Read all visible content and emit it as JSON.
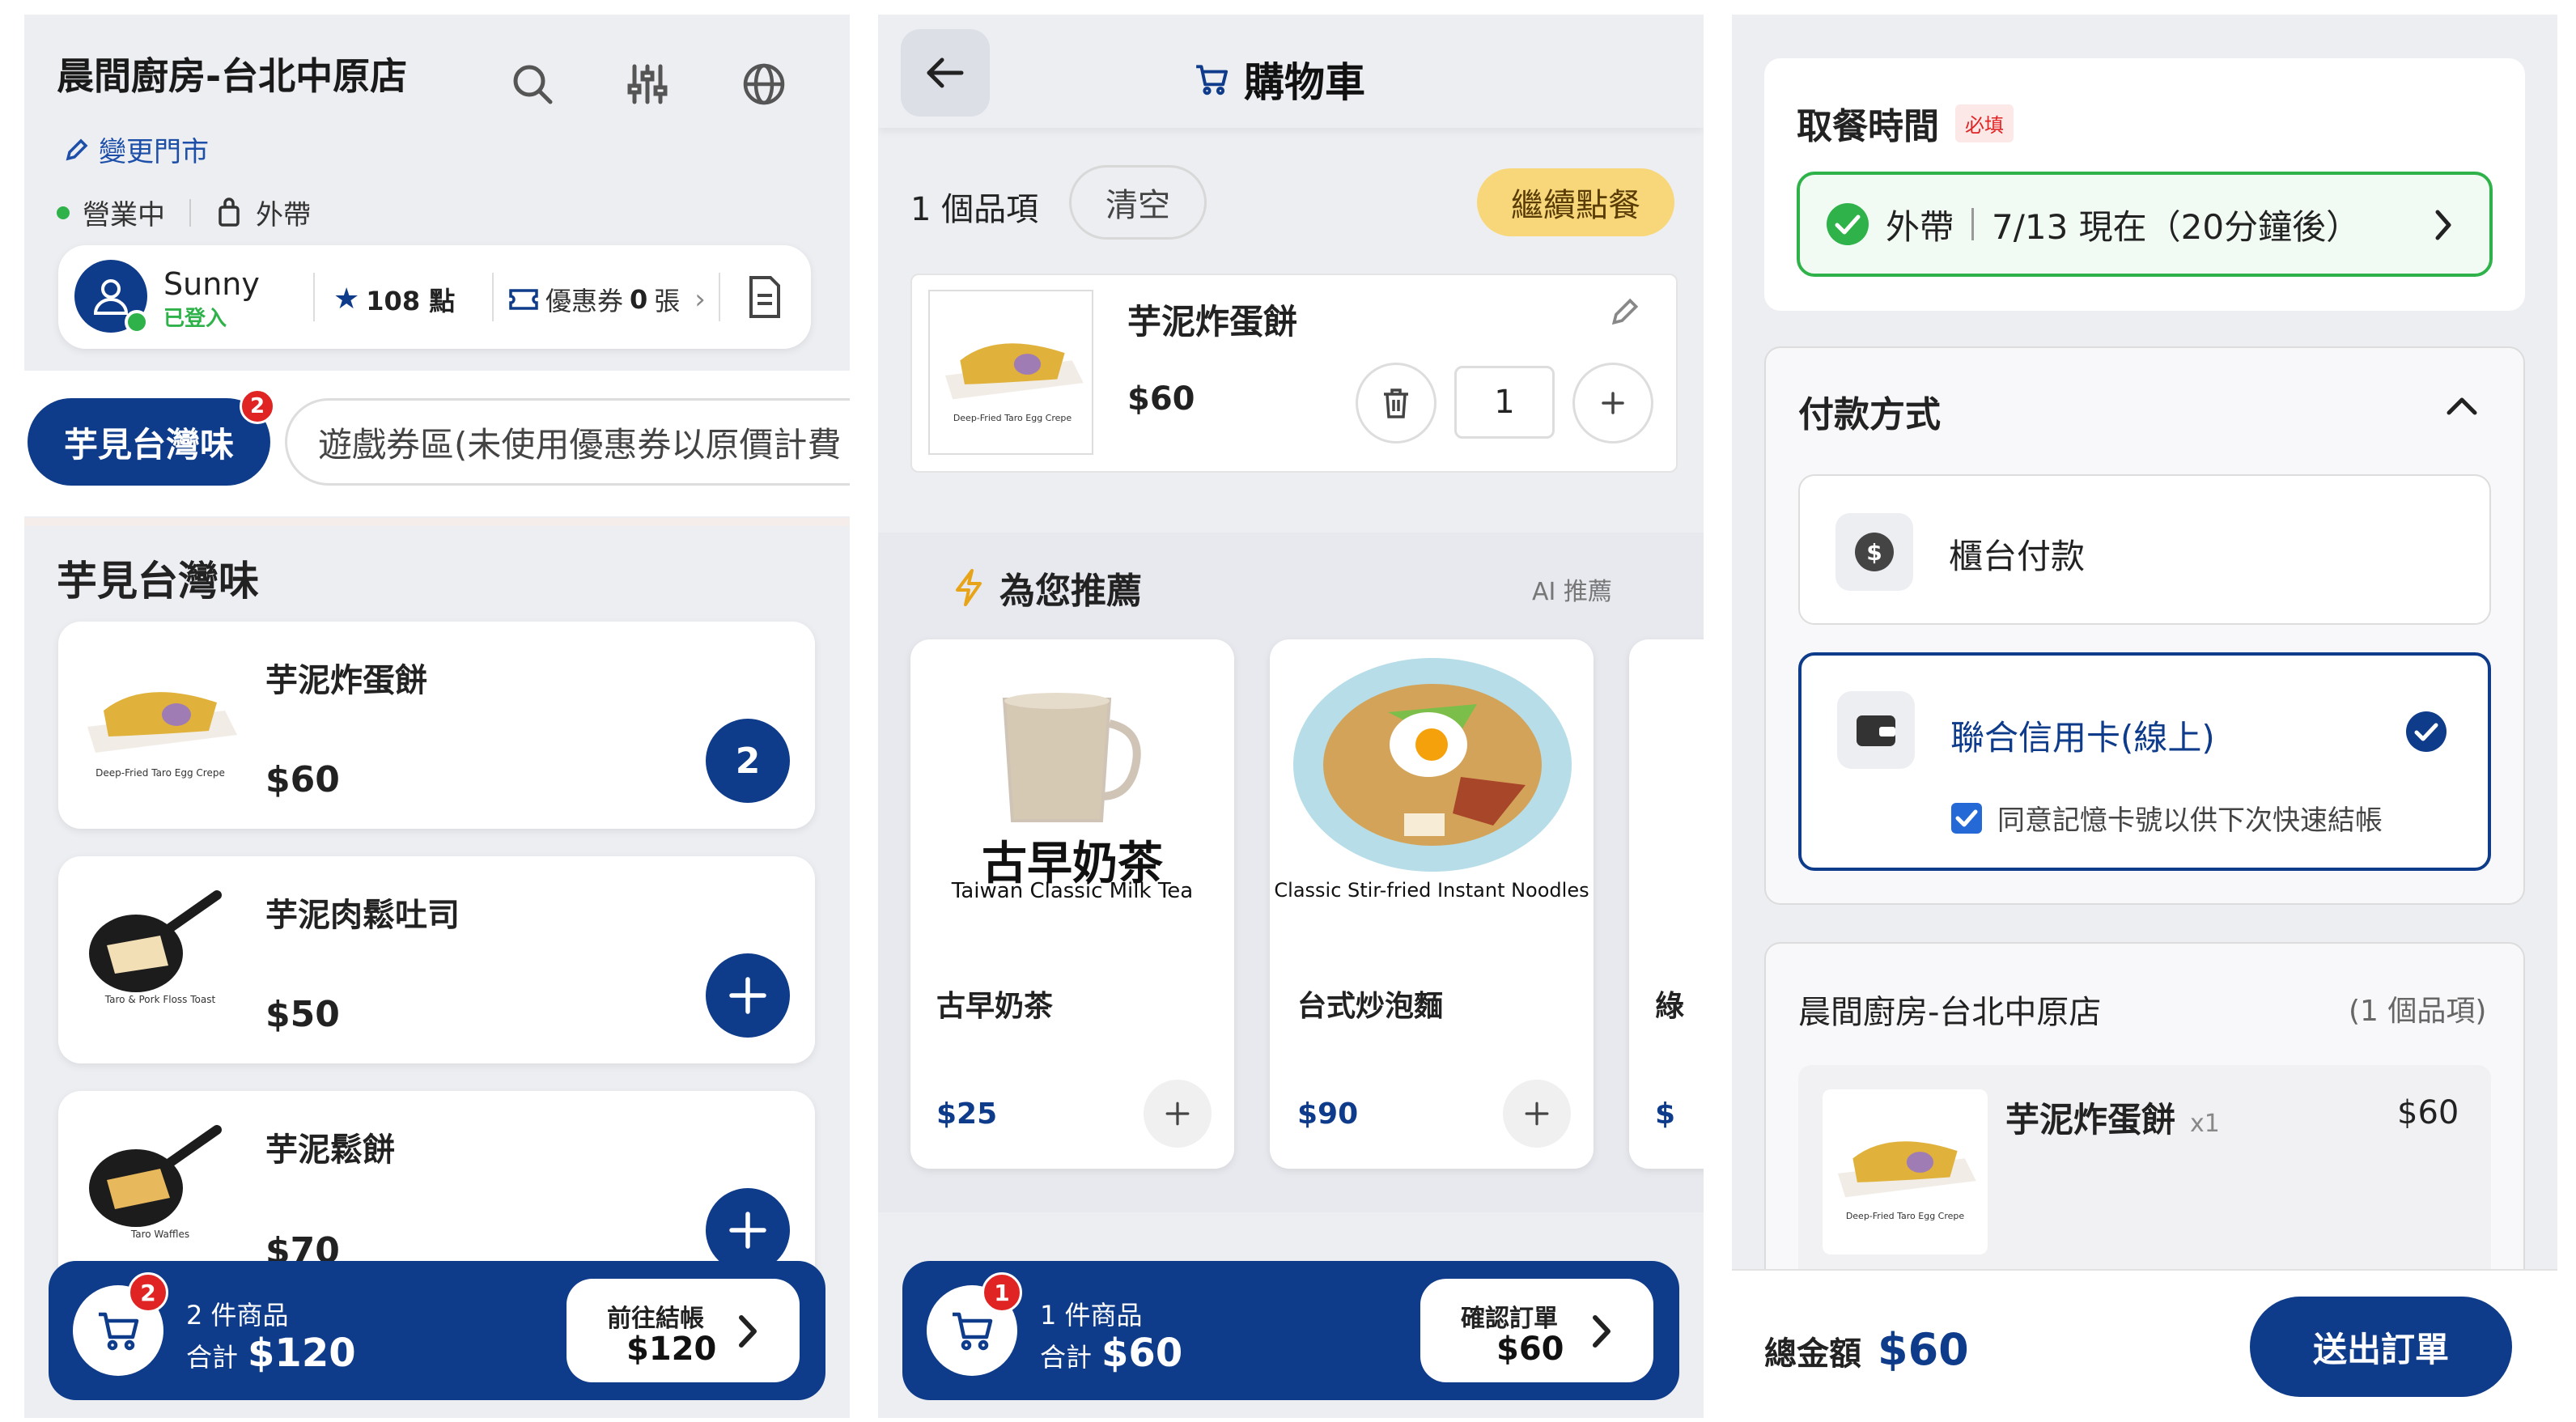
{
  "menu": {
    "store_name": "晨間廚房-台北中原店",
    "change_store": "變更門市",
    "status": "營業中",
    "mode": "外帶",
    "user": {
      "name": "Sunny",
      "status": "已登入",
      "points": "108 點",
      "coupon_label": "優惠券",
      "coupon_count": "0",
      "coupon_unit": "張"
    },
    "tabs": [
      {
        "label": "芋見台灣味",
        "badge": "2"
      },
      {
        "label": "遊戲券區(未使用優惠券以原價計費"
      }
    ],
    "section_title": "芋見台灣味",
    "items": [
      {
        "name": "芋泥炸蛋餅",
        "price": "$60",
        "caption": "Deep-Fried Taro Egg Crepe",
        "qty": "2"
      },
      {
        "name": "芋泥肉鬆吐司",
        "price": "$50",
        "caption": "Taro & Pork Floss Toast"
      },
      {
        "name": "芋泥鬆餅",
        "price": "$70",
        "caption": "Taro Waffles"
      }
    ],
    "cart_bar": {
      "badge": "2",
      "count_text": "2 件商品",
      "total_label": "合計",
      "total": "$120",
      "checkout_label": "前往結帳",
      "checkout_price": "$120"
    }
  },
  "cart": {
    "title": "購物車",
    "item_count": "1 個品項",
    "clear": "清空",
    "continue": "繼續點餐",
    "item": {
      "name": "芋泥炸蛋餅",
      "price": "$60",
      "qty": "1",
      "caption": "Deep-Fried Taro Egg Crepe"
    },
    "recommend_title": "為您推薦",
    "recommend_tag": "AI 推薦",
    "recommendations": [
      {
        "name": "古早奶茶",
        "price": "$25",
        "img_title": "古早奶茶",
        "img_caption": "Taiwan Classic Milk Tea"
      },
      {
        "name": "台式炒泡麵",
        "price": "$90",
        "img_caption": "Classic Stir-fried Instant Noodles"
      },
      {
        "name": "綠",
        "price": "$"
      }
    ],
    "cart_bar": {
      "badge": "1",
      "count_text": "1 件商品",
      "total_label": "合計",
      "total": "$60",
      "confirm_label": "確認訂單",
      "confirm_price": "$60"
    }
  },
  "checkout": {
    "pickup_title": "取餐時間",
    "required": "必填",
    "pickup_mode": "外帶",
    "pickup_time": "7/13 現在（20分鐘後）",
    "payment_title": "付款方式",
    "payment_options": [
      {
        "label": "櫃台付款",
        "selected": false
      },
      {
        "label": "聯合信用卡(線上)",
        "selected": true,
        "remember": "同意記憶卡號以供下次快速結帳"
      }
    ],
    "summary_store": "晨間廚房-台北中原店",
    "summary_count": "(1 個品項)",
    "summary_item": {
      "name": "芋泥炸蛋餅",
      "qty": "x1",
      "price": "$60",
      "caption": "Deep-Fried Taro Egg Crepe"
    },
    "total_label": "總金額",
    "total": "$60",
    "submit": "送出訂單"
  },
  "colors": {
    "navy": "#0e3b8a",
    "green": "#2fb24a",
    "yellow": "#f8d77a",
    "red": "#e02424",
    "background": "#eceef2"
  }
}
